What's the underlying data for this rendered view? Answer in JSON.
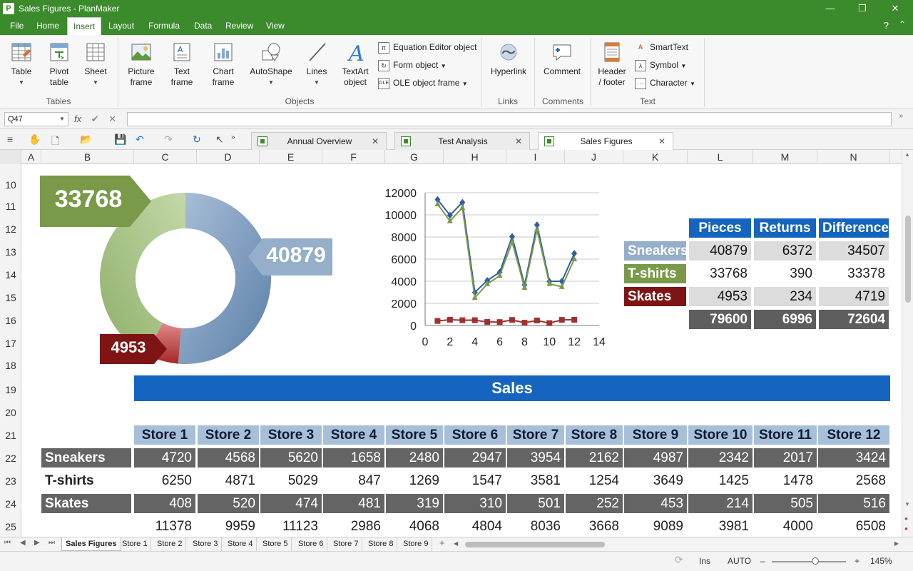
{
  "window": {
    "title": "Sales Figures - PlanMaker",
    "app_icon": "P",
    "minimize": "—",
    "restore": "❐",
    "close": "✕"
  },
  "menu": {
    "tabs": [
      "File",
      "Home",
      "Insert",
      "Layout",
      "Formula",
      "Data",
      "Review",
      "View"
    ],
    "active": "Insert",
    "help": "?",
    "collapse": "⌃"
  },
  "ribbon": {
    "table": "Table",
    "pivot_table": "Pivot\ntable",
    "sheet": "Sheet",
    "tables_group": "Tables",
    "picture_frame": "Picture\nframe",
    "text_frame": "Text\nframe",
    "chart_frame": "Chart\nframe",
    "autoshape": "AutoShape",
    "lines": "Lines",
    "textart": "TextArt\nobject",
    "equation": "Equation Editor object",
    "form_object": "Form object",
    "ole_object": "OLE object frame",
    "objects_group": "Objects",
    "hyperlink": "Hyperlink",
    "links_group": "Links",
    "comment": "Comment",
    "comments_group": "Comments",
    "header_footer": "Header\n/ footer",
    "smarttext": "SmartText",
    "symbol": "Symbol",
    "character": "Character",
    "text_group": "Text"
  },
  "formula_bar": {
    "cell_ref": "Q47",
    "fx": "fx",
    "ok": "✔",
    "cancel": "✕",
    "value": ""
  },
  "doc_tabs": [
    {
      "name": "Annual Overview",
      "close": "✕"
    },
    {
      "name": "Test Analysis",
      "close": "✕"
    },
    {
      "name": "Sales Figures",
      "close": "✕"
    }
  ],
  "columns": [
    "A",
    "B",
    "C",
    "D",
    "E",
    "F",
    "G",
    "H",
    "I",
    "J",
    "K",
    "L",
    "M",
    "N"
  ],
  "rows": [
    "10",
    "11",
    "12",
    "13",
    "14",
    "15",
    "16",
    "17",
    "18",
    "19",
    "20",
    "21",
    "22",
    "23",
    "24",
    "25"
  ],
  "donut_labels": {
    "tshirts": "33768",
    "sneakers": "40879",
    "skates": "4953"
  },
  "summary": {
    "headers": [
      "Pieces",
      "Returns",
      "Difference"
    ],
    "rows": [
      {
        "label": "Sneakers",
        "values": [
          "40879",
          "6372",
          "34507"
        ]
      },
      {
        "label": "T-shirts",
        "values": [
          "33768",
          "390",
          "33378"
        ]
      },
      {
        "label": "Skates",
        "values": [
          "4953",
          "234",
          "4719"
        ]
      }
    ],
    "totals": [
      "79600",
      "6996",
      "72604"
    ]
  },
  "sales_title": "Sales",
  "stores": [
    "Store 1",
    "Store 2",
    "Store 3",
    "Store 4",
    "Store 5",
    "Store 6",
    "Store 7",
    "Store 8",
    "Store 9",
    "Store 10",
    "Store 11",
    "Store 12"
  ],
  "sales_rows": [
    {
      "label": "Sneakers",
      "values": [
        "4720",
        "4568",
        "5620",
        "1658",
        "2480",
        "2947",
        "3954",
        "2162",
        "4987",
        "2342",
        "2017",
        "3424"
      ]
    },
    {
      "label": "T-shirts",
      "values": [
        "6250",
        "4871",
        "5029",
        "847",
        "1269",
        "1547",
        "3581",
        "1254",
        "3649",
        "1425",
        "1478",
        "2568"
      ]
    },
    {
      "label": "Skates",
      "values": [
        "408",
        "520",
        "474",
        "481",
        "319",
        "310",
        "501",
        "252",
        "453",
        "214",
        "505",
        "516"
      ]
    },
    {
      "label": "",
      "values": [
        "11378",
        "9959",
        "11123",
        "2986",
        "4068",
        "4804",
        "8036",
        "3668",
        "9089",
        "3981",
        "4000",
        "6508"
      ]
    }
  ],
  "sheet_tabs": [
    "Sales Figures",
    "Store 1",
    "Store 2",
    "Store 3",
    "Store 4",
    "Store 5",
    "Store 6",
    "Store 7",
    "Store 8",
    "Store 9"
  ],
  "add_sheet": "+",
  "status": {
    "ins": "Ins",
    "auto": "AUTO",
    "zoom": "145%",
    "minus": "–",
    "plus": "+"
  },
  "colors": {
    "green": "#3b8a2c",
    "blue": "#1565c0",
    "sneakers": "#95aec9",
    "tshirts": "#7a9a4a",
    "skates": "#7e1414"
  },
  "chart_data": [
    {
      "type": "pie",
      "subtype": "donut",
      "categories": [
        "Sneakers",
        "T-shirts",
        "Skates"
      ],
      "values": [
        40879,
        33768,
        4953
      ],
      "colors": [
        "#6f8fb5",
        "#9ebf7e",
        "#b23a3a"
      ]
    },
    {
      "type": "line",
      "xlim": [
        0,
        14
      ],
      "ylim": [
        0,
        12000
      ],
      "x_ticks": [
        0,
        2,
        4,
        6,
        8,
        10,
        12,
        14
      ],
      "y_ticks": [
        0,
        2000,
        4000,
        6000,
        8000,
        10000,
        12000
      ],
      "grid": true,
      "series": [
        {
          "x": [
            1,
            2,
            3,
            4,
            5,
            6,
            7,
            8,
            9,
            10,
            11,
            12
          ],
          "values": [
            11378,
            9959,
            11123,
            2986,
            4068,
            4804,
            8036,
            3668,
            9089,
            3981,
            4000,
            6508
          ],
          "color": "#2f5f9e",
          "marker": "diamond"
        },
        {
          "x": [
            1,
            2,
            3,
            4,
            5,
            6,
            7,
            8,
            9,
            10,
            11,
            12
          ],
          "values": [
            10970,
            9439,
            10649,
            2505,
            3749,
            4494,
            7535,
            3416,
            8636,
            3767,
            3495,
            5992
          ],
          "color": "#7a9a4a",
          "marker": "triangle"
        },
        {
          "x": [
            1,
            2,
            3,
            4,
            5,
            6,
            7,
            8,
            9,
            10,
            11,
            12
          ],
          "values": [
            408,
            520,
            474,
            481,
            319,
            310,
            501,
            252,
            453,
            214,
            505,
            516
          ],
          "color": "#a03030",
          "marker": "square"
        }
      ]
    }
  ]
}
